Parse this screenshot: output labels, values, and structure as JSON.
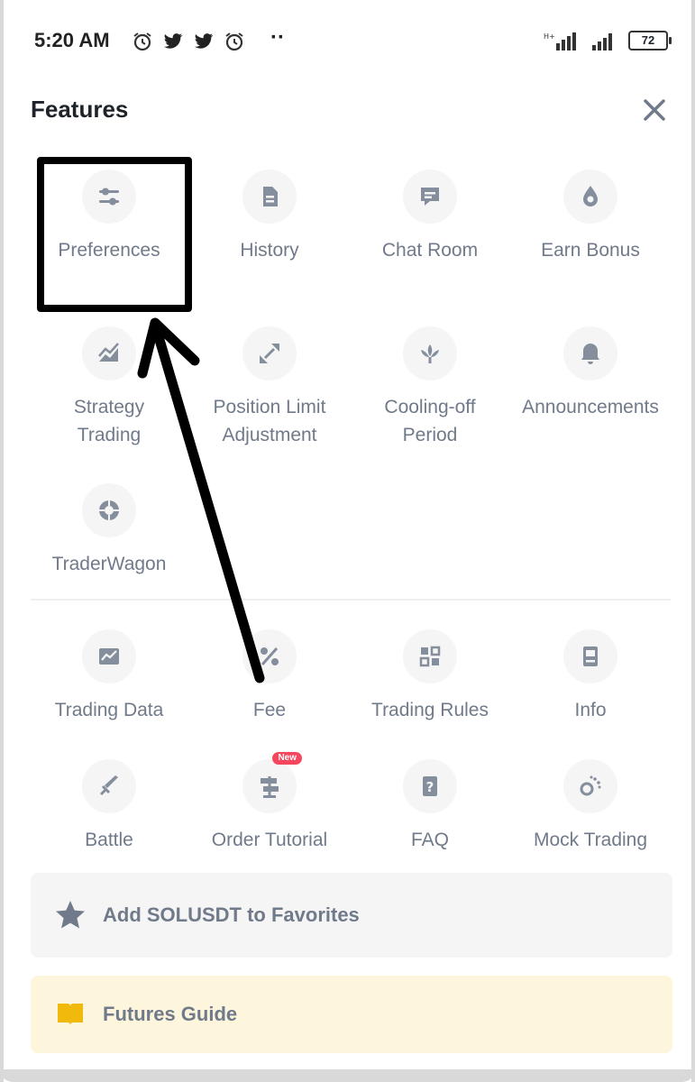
{
  "status_bar": {
    "time": "5:20 AM",
    "dots": "··",
    "battery": "72",
    "icons": [
      "alarm-icon",
      "twitter-icon",
      "twitter-icon",
      "alarm-icon"
    ]
  },
  "panel": {
    "title": "Features"
  },
  "features_top": [
    {
      "label": "Preferences",
      "icon": "sliders-icon"
    },
    {
      "label": "History",
      "icon": "document-icon"
    },
    {
      "label": "Chat Room",
      "icon": "chat-icon"
    },
    {
      "label": "Earn Bonus",
      "icon": "drop-icon"
    },
    {
      "label": "Strategy\nTrading",
      "icon": "chart-trend-icon"
    },
    {
      "label": "Position Limit\nAdjustment",
      "icon": "expand-icon"
    },
    {
      "label": "Cooling-off\nPeriod",
      "icon": "lotus-icon"
    },
    {
      "label": "Announcements",
      "icon": "bell-icon"
    },
    {
      "label": "TraderWagon",
      "icon": "wagon-icon"
    }
  ],
  "features_bottom": [
    {
      "label": "Trading Data",
      "icon": "data-chart-icon"
    },
    {
      "label": "Fee",
      "icon": "percent-icon"
    },
    {
      "label": "Trading Rules",
      "icon": "rules-grid-icon"
    },
    {
      "label": "Info",
      "icon": "info-doc-icon"
    },
    {
      "label": "Battle",
      "icon": "sword-icon"
    },
    {
      "label": "Order Tutorial",
      "icon": "signpost-icon",
      "badge": "New"
    },
    {
      "label": "FAQ",
      "icon": "faq-doc-icon"
    },
    {
      "label": "Mock Trading",
      "icon": "mock-icon"
    }
  ],
  "favorites": {
    "label": "Add SOLUSDT to Favorites",
    "icon": "star-icon"
  },
  "guide": {
    "label": "Futures Guide",
    "icon": "book-icon",
    "color": "#f0b90b"
  }
}
